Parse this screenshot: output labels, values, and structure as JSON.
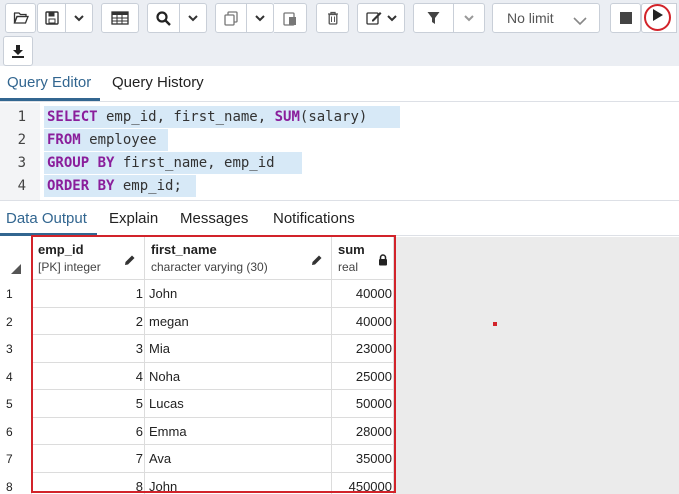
{
  "toolbar": {
    "open_file_icon": "folder-open-icon",
    "save_icon": "floppy-disk-icon",
    "limit_select": {
      "value": "No limit"
    },
    "run_icon": "play-icon"
  },
  "editor_tabs": [
    "Query Editor",
    "Query History"
  ],
  "editor": {
    "lines": [
      {
        "number": "1",
        "tokens": [
          [
            "kw",
            "SELECT"
          ],
          [
            "tx",
            " emp_id, first_name, "
          ],
          [
            "kw",
            "SUM"
          ],
          [
            "tx",
            "(salary)"
          ]
        ]
      },
      {
        "number": "2",
        "tokens": [
          [
            "kw",
            "FROM"
          ],
          [
            "tx",
            " employee"
          ]
        ]
      },
      {
        "number": "3",
        "tokens": [
          [
            "kw",
            "GROUP BY"
          ],
          [
            "tx",
            " first_name, emp_id"
          ]
        ]
      },
      {
        "number": "4",
        "tokens": [
          [
            "kw",
            "ORDER BY"
          ],
          [
            "tx",
            " emp_id;"
          ]
        ]
      }
    ]
  },
  "result_tabs": [
    "Data Output",
    "Explain",
    "Messages",
    "Notifications"
  ],
  "grid": {
    "columns": [
      {
        "name": "emp_id",
        "type": "[PK] integer",
        "icon": "pencil-icon"
      },
      {
        "name": "first_name",
        "type": "character varying (30)",
        "icon": "pencil-icon"
      },
      {
        "name": "sum",
        "type": "real",
        "icon": "lock-icon"
      }
    ],
    "rows": [
      {
        "n": "1",
        "emp_id": "1",
        "first_name": "John",
        "sum": "40000"
      },
      {
        "n": "2",
        "emp_id": "2",
        "first_name": "megan",
        "sum": "40000"
      },
      {
        "n": "3",
        "emp_id": "3",
        "first_name": "Mia",
        "sum": "23000"
      },
      {
        "n": "4",
        "emp_id": "4",
        "first_name": "Noha",
        "sum": "25000"
      },
      {
        "n": "5",
        "emp_id": "5",
        "first_name": "Lucas",
        "sum": "50000"
      },
      {
        "n": "6",
        "emp_id": "6",
        "first_name": "Emma",
        "sum": "28000"
      },
      {
        "n": "7",
        "emp_id": "7",
        "first_name": "Ava",
        "sum": "35000"
      },
      {
        "n": "8",
        "emp_id": "8",
        "first_name": "John",
        "sum": "450000"
      }
    ]
  },
  "colors": {
    "accent": "#326690",
    "highlight": "#d2232a",
    "keyword": "#8a1e9b",
    "selection": "#d7e9f7"
  }
}
